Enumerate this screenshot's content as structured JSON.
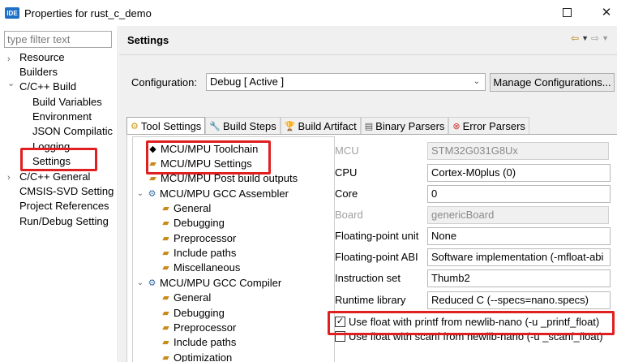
{
  "window": {
    "icon_text": "IDE",
    "title": "Properties for rust_c_demo"
  },
  "sidebar": {
    "filter_placeholder": "type filter text",
    "items": [
      {
        "label": "Resource",
        "arrow": "›"
      },
      {
        "label": "Builders"
      },
      {
        "label": "C/C++ Build",
        "arrow": "⌄"
      },
      {
        "label": "Build Variables"
      },
      {
        "label": "Environment"
      },
      {
        "label": "JSON Compilatic"
      },
      {
        "label": "Logging"
      },
      {
        "label": "Settings"
      },
      {
        "label": "C/C++ General",
        "arrow": "›"
      },
      {
        "label": "CMSIS-SVD Setting"
      },
      {
        "label": "Project References"
      },
      {
        "label": "Run/Debug Setting"
      }
    ]
  },
  "header": {
    "title": "Settings"
  },
  "configuration": {
    "label": "Configuration:",
    "value": "Debug  [ Active ]",
    "manage_button": "Manage Configurations..."
  },
  "tabs": [
    {
      "label": "Tool Settings"
    },
    {
      "label": "Build Steps"
    },
    {
      "label": "Build Artifact"
    },
    {
      "label": "Binary Parsers"
    },
    {
      "label": "Error Parsers"
    }
  ],
  "tool_tree": [
    {
      "label": "MCU/MPU Toolchain"
    },
    {
      "label": "MCU/MPU Settings"
    },
    {
      "label": "MCU/MPU Post build outputs"
    },
    {
      "label": "MCU/MPU GCC Assembler"
    },
    {
      "label": "General"
    },
    {
      "label": "Debugging"
    },
    {
      "label": "Preprocessor"
    },
    {
      "label": "Include paths"
    },
    {
      "label": "Miscellaneous"
    },
    {
      "label": "MCU/MPU GCC Compiler"
    },
    {
      "label": "General"
    },
    {
      "label": "Debugging"
    },
    {
      "label": "Preprocessor"
    },
    {
      "label": "Include paths"
    },
    {
      "label": "Optimization"
    }
  ],
  "properties": [
    {
      "label": "MCU",
      "value": "STM32G031G8Ux"
    },
    {
      "label": "CPU",
      "value": "Cortex-M0plus (0)"
    },
    {
      "label": "Core",
      "value": "0"
    },
    {
      "label": "Board",
      "value": "genericBoard"
    },
    {
      "label": "Floating-point unit",
      "value": "None"
    },
    {
      "label": "Floating-point ABI",
      "value": "Software implementation (-mfloat-abi"
    },
    {
      "label": "Instruction set",
      "value": "Thumb2"
    },
    {
      "label": "Runtime library",
      "value": "Reduced C (--specs=nano.specs)"
    }
  ],
  "checkboxes": [
    {
      "label": "Use float with printf from newlib-nano (-u _printf_float)",
      "checked": true
    },
    {
      "label": "Use float with scanf from newlib-nano (-u _scanf_float)",
      "checked": false
    }
  ],
  "colors": {
    "highlight": "#e02020",
    "accent": "#1f6fc7"
  }
}
